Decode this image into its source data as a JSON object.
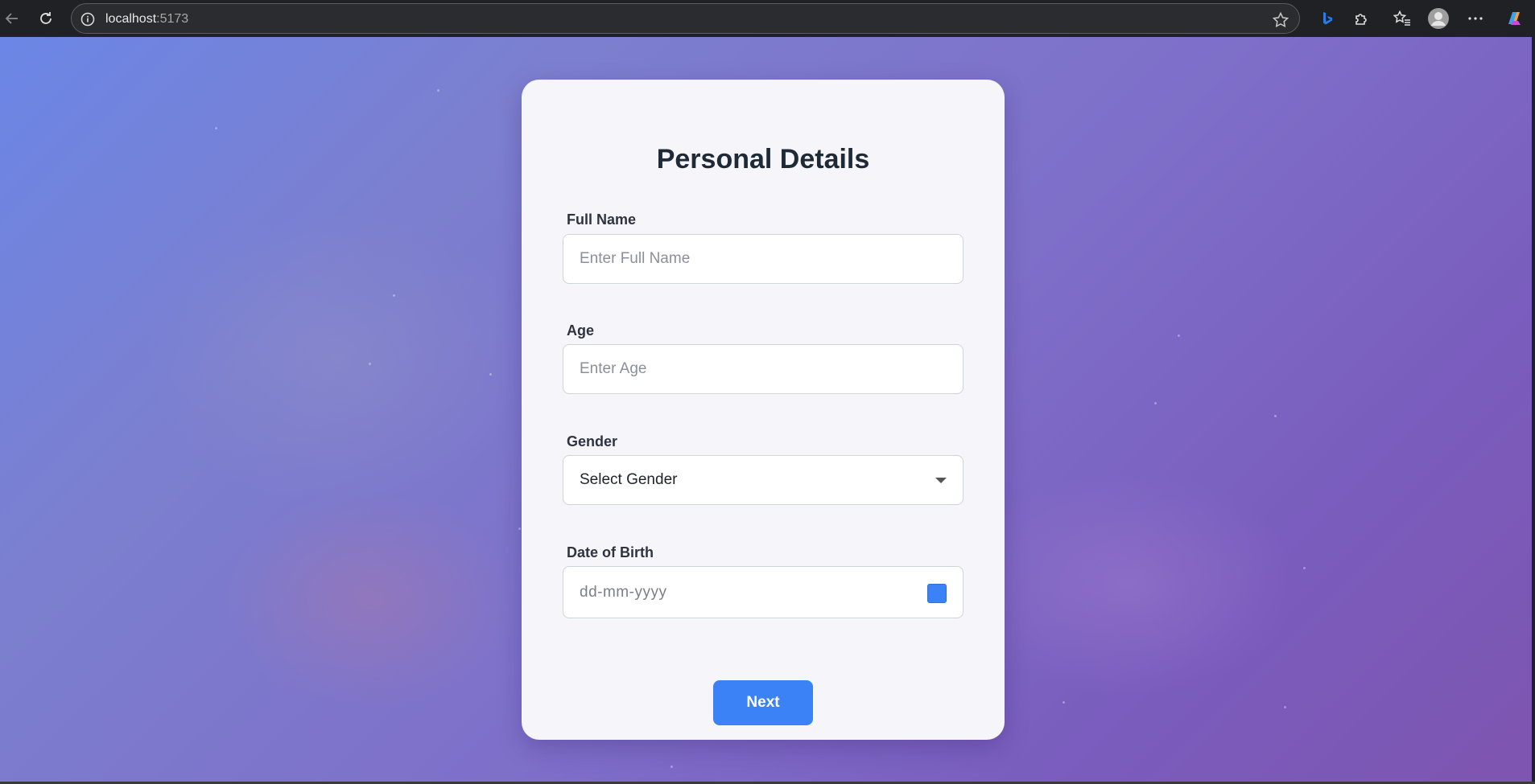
{
  "browser": {
    "url_host": "localhost",
    "url_port": ":5173"
  },
  "form": {
    "title": "Personal Details",
    "full_name": {
      "label": "Full Name",
      "placeholder": "Enter Full Name"
    },
    "age": {
      "label": "Age",
      "placeholder": "Enter Age"
    },
    "gender": {
      "label": "Gender",
      "selected": "Select Gender"
    },
    "dob": {
      "label": "Date of Birth",
      "placeholder": "dd-mm-yyyy"
    },
    "next_label": "Next"
  },
  "colors": {
    "accent": "#3b82f6",
    "gradient_start": "#6b86e6",
    "gradient_end": "#7e55b0",
    "card_bg": "#f6f5f9"
  }
}
